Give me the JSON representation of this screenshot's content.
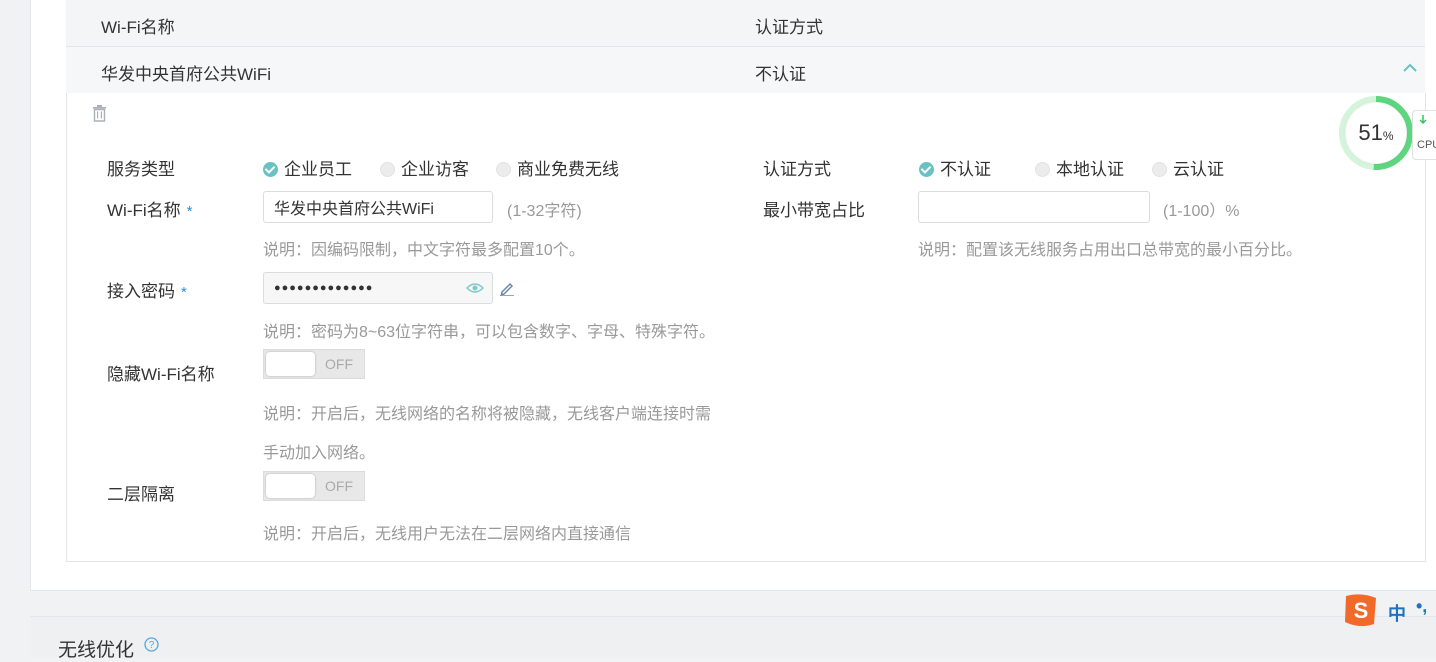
{
  "table": {
    "headers": [
      "Wi-Fi名称",
      "认证方式"
    ],
    "row": {
      "name": "华发中央首府公共WiFi",
      "auth": "不认证"
    }
  },
  "icons": {
    "collapse": "chevron-up-icon",
    "delete": "trash-icon",
    "show_password": "eye-icon",
    "edit": "pencil-icon",
    "help": "question-circle-icon"
  },
  "form": {
    "service_type": {
      "label": "服务类型",
      "options": [
        "企业员工",
        "企业访客",
        "商业免费无线"
      ],
      "selected": "企业员工"
    },
    "auth_method": {
      "label": "认证方式",
      "options": [
        "不认证",
        "本地认证",
        "云认证"
      ],
      "selected": "不认证"
    },
    "wifi_name": {
      "label": "Wi-Fi名称",
      "required_mark": "*",
      "value": "华发中央首府公共WiFi",
      "hint": "(1-32字符)",
      "note": "说明：因编码限制，中文字符最多配置10个。"
    },
    "min_bandwidth": {
      "label": "最小带宽占比",
      "value": "",
      "hint": "(1-100）%",
      "note": "说明：配置该无线服务占用出口总带宽的最小百分比。"
    },
    "password": {
      "label": "接入密码",
      "required_mark": "*",
      "masked_value": "●●●●●●●●●●●●●",
      "note": "说明：密码为8~63位字符串，可以包含数字、字母、特殊字符。"
    },
    "hide_ssid": {
      "label": "隐藏Wi-Fi名称",
      "state": "OFF",
      "note_line1": "说明：开启后，无线网络的名称将被隐藏，无线客户端连接时需",
      "note_line2": "手动加入网络。"
    },
    "l2_isolation": {
      "label": "二层隔离",
      "state": "OFF",
      "note": "说明：开启后，无线用户无法在二层网络内直接通信"
    }
  },
  "section2": {
    "title": "无线优化"
  },
  "cpu_widget": {
    "percent_value": 51,
    "percent_text": "51",
    "percent_sign": "%",
    "label": "CPU",
    "color": "#5ed57f"
  },
  "ime": {
    "mode": "中",
    "punct": "•,"
  },
  "colors": {
    "accent": "#2f8ecf",
    "radio_checked": "#68c2c1",
    "chevron": "#68c2c1"
  }
}
